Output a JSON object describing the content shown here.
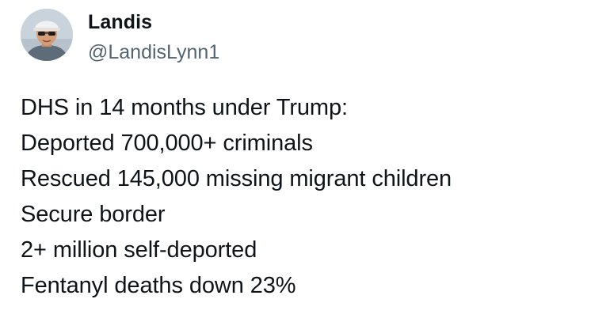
{
  "author": {
    "name": "Landis",
    "handle": "@LandisLynn1",
    "avatar_icon": "profile-photo-man-cap-sunglasses"
  },
  "tweet": {
    "lines": [
      "DHS in 14 months under Trump:",
      "Deported 700,000+ criminals",
      "Rescued 145,000 missing migrant children",
      "Secure border",
      "2+ million self-deported",
      "Fentanyl deaths down 23%"
    ]
  },
  "colors": {
    "text": "#0f1419",
    "secondary_text": "#536471",
    "background": "#ffffff"
  }
}
